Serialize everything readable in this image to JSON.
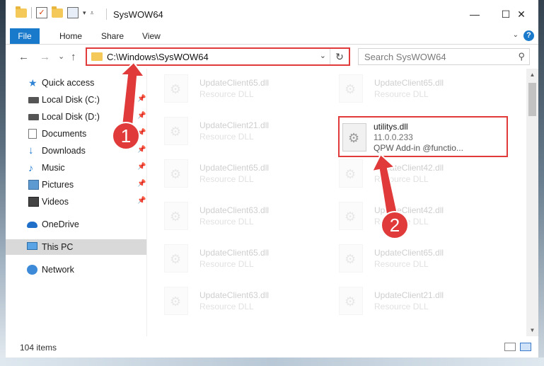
{
  "window": {
    "title": "SysWOW64",
    "controls": {
      "minimize": "—",
      "maximize": "☐",
      "close": "✕"
    }
  },
  "ribbon": {
    "tabs": [
      "File",
      "Home",
      "Share",
      "View"
    ],
    "help": "?"
  },
  "nav": {
    "back": "←",
    "forward": "→",
    "recent": "⌄",
    "up": "↑",
    "address": "C:\\Windows\\SysWOW64",
    "refresh": "↻",
    "search_placeholder": "Search SysWOW64"
  },
  "sidebar": {
    "items": [
      {
        "label": "Quick access",
        "icon": "star-icon",
        "pinned": false
      },
      {
        "label": "Local Disk (C:)",
        "icon": "drive-icon",
        "pinned": true
      },
      {
        "label": "Local Disk (D:)",
        "icon": "drive-icon",
        "pinned": true
      },
      {
        "label": "Documents",
        "icon": "documents-icon",
        "pinned": true
      },
      {
        "label": "Downloads",
        "icon": "download-icon",
        "pinned": true
      },
      {
        "label": "Music",
        "icon": "music-icon",
        "pinned": true
      },
      {
        "label": "Pictures",
        "icon": "pictures-icon",
        "pinned": true
      },
      {
        "label": "Videos",
        "icon": "videos-icon",
        "pinned": true
      },
      {
        "label": "OneDrive",
        "icon": "cloud-icon",
        "pinned": false
      },
      {
        "label": "This PC",
        "icon": "computer-icon",
        "pinned": false,
        "selected": true
      },
      {
        "label": "Network",
        "icon": "network-icon",
        "pinned": false
      }
    ]
  },
  "files": {
    "left_column": [
      {
        "name": "UpdateClient65.dll",
        "type": "Resource DLL"
      },
      {
        "name": "UpdateClient21.dll",
        "type": "Resource DLL"
      },
      {
        "name": "UpdateClient65.dll",
        "type": "Resource DLL"
      },
      {
        "name": "UpdateClient63.dll",
        "type": "Resource DLL"
      },
      {
        "name": "UpdateClient65.dll",
        "type": "Resource DLL"
      },
      {
        "name": "UpdateClient63.dll",
        "type": "Resource DLL"
      }
    ],
    "right_column": [
      {
        "name": "UpdateClient65.dll",
        "type": "Resource DLL"
      },
      {
        "name": "UpdateClient42.dll",
        "type": "Resource DLL"
      },
      {
        "name": "UpdateClient42.dll",
        "type": "Resource DLL"
      },
      {
        "name": "UpdateClient65.dll",
        "type": "Resource DLL"
      },
      {
        "name": "UpdateClient21.dll",
        "type": "Resource DLL"
      }
    ],
    "highlighted": {
      "name": "utilitys.dll",
      "version": "11.0.0.233",
      "description": "QPW Add-in @functio..."
    }
  },
  "status": {
    "item_count": "104 items"
  },
  "annotations": {
    "step1": "1",
    "step2": "2",
    "color": "#e03a3a"
  }
}
